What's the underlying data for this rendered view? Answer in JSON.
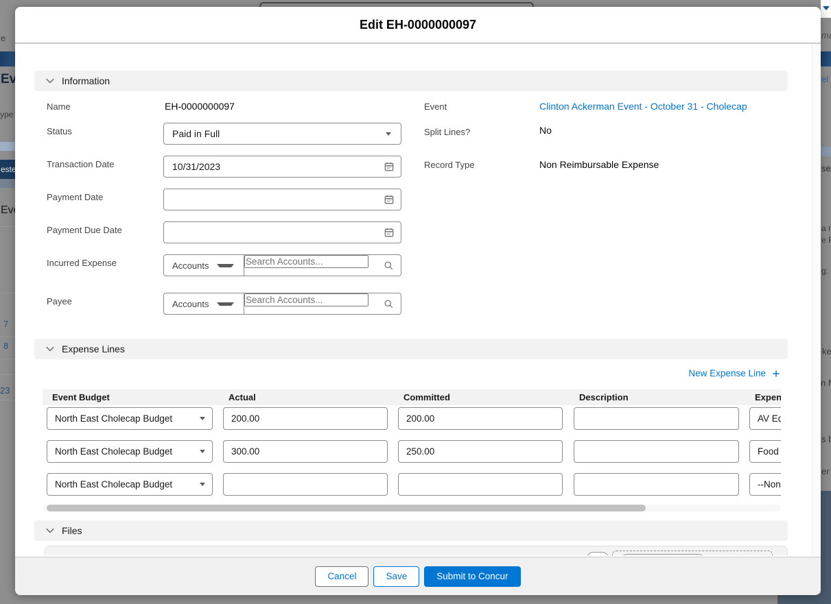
{
  "modal": {
    "title": "Edit EH-0000000097",
    "sections": {
      "information": {
        "label": "Information",
        "fields": {
          "name": {
            "label": "Name",
            "value": "EH-0000000097"
          },
          "status": {
            "label": "Status",
            "value": "Paid in Full"
          },
          "transaction_date": {
            "label": "Transaction Date",
            "value": "10/31/2023"
          },
          "payment_date": {
            "label": "Payment Date",
            "value": ""
          },
          "payment_due_date": {
            "label": "Payment Due Date",
            "value": ""
          },
          "incurred_expense": {
            "label": "Incurred Expense",
            "entity": "Accounts",
            "placeholder": "Search Accounts..."
          },
          "payee": {
            "label": "Payee",
            "entity": "Accounts",
            "placeholder": "Search Accounts..."
          },
          "event": {
            "label": "Event",
            "value": "Clinton Ackerman Event - October 31 - Cholecap"
          },
          "split_lines": {
            "label": "Split Lines?",
            "value": "No"
          },
          "record_type": {
            "label": "Record Type",
            "value": "Non Reimbursable Expense"
          }
        }
      },
      "expense_lines": {
        "label": "Expense Lines",
        "new_line_label": "New Expense Line",
        "columns": [
          "Event Budget",
          "Actual",
          "Committed",
          "Description",
          "Expens"
        ],
        "rows": [
          {
            "event_budget": "North East Cholecap Budget",
            "actual": "200.00",
            "committed": "200.00",
            "description": "",
            "expense_type": "AV Eq"
          },
          {
            "event_budget": "North East Cholecap Budget",
            "actual": "300.00",
            "committed": "250.00",
            "description": "",
            "expense_type": "Food"
          },
          {
            "event_budget": "North East Cholecap Budget",
            "actual": "",
            "committed": "",
            "description": "",
            "expense_type": "--Non"
          }
        ]
      },
      "files": {
        "label": "Files"
      }
    },
    "footer": {
      "cancel_label": "Cancel",
      "save_label": "Save",
      "submit_label": "Submit to Concur"
    }
  },
  "background": {
    "fragments": [
      "e",
      "Ev",
      "ype",
      "este",
      "Eve",
      "7",
      "8",
      "23",
      "ma",
      "el",
      "se",
      "a r",
      "e R",
      "g:",
      "ke",
      "n M",
      "s b",
      "er"
    ]
  },
  "colors": {
    "accent": "#0176d3",
    "backdrop": "#8e8e8e",
    "section_bar": "#f2f2f2",
    "navy": "#1f4267",
    "slate": "#4a5a6c"
  },
  "icons": {
    "section_chevron": "chevron-down",
    "date": "calendar",
    "lookup_search": "magnifier",
    "select_arrow": "triangle-down",
    "new_line": "plus"
  }
}
